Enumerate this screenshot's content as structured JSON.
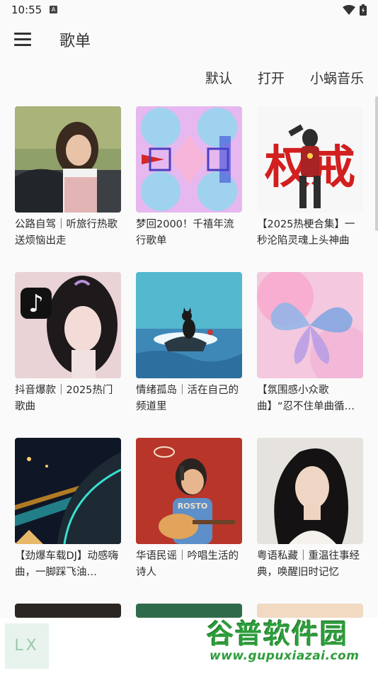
{
  "status": {
    "time": "10:55",
    "notif_badge": "A"
  },
  "app_bar": {
    "title": "歌单"
  },
  "sort_options": [
    "默认",
    "打开",
    "小蜗音乐"
  ],
  "playlists": [
    {
      "title": "公路自驾｜听旅行热歌送烦恼出走"
    },
    {
      "title": "梦回2000！千禧年流行歌单"
    },
    {
      "title": "【2025热梗合集】一秒沦陷灵魂上头神曲"
    },
    {
      "title": "抖音爆款｜2025热门歌曲"
    },
    {
      "title": "情绪孤岛｜活在自己的频道里"
    },
    {
      "title": "【氛围感小众歌曲】“忍不住单曲循…"
    },
    {
      "title": "【劲爆车载DJ】动感嗨曲，一脚踩飞油…"
    },
    {
      "title": "华语民谣｜吟唱生活的诗人"
    },
    {
      "title": "粤语私藏｜重温往事经典，唤醒旧时记忆"
    }
  ],
  "cover_texts": {
    "ultraman": "权戒",
    "tiktok_glyph": "♪",
    "guitar_shirt": "ROSTO"
  },
  "bottom": {
    "app_logo": "LX"
  },
  "watermark": {
    "main": "谷普软件园",
    "url": "www.gupuxiazai.com"
  },
  "colors": {
    "accent_green": "#2e9d3b",
    "red_text": "#d21f1f"
  }
}
